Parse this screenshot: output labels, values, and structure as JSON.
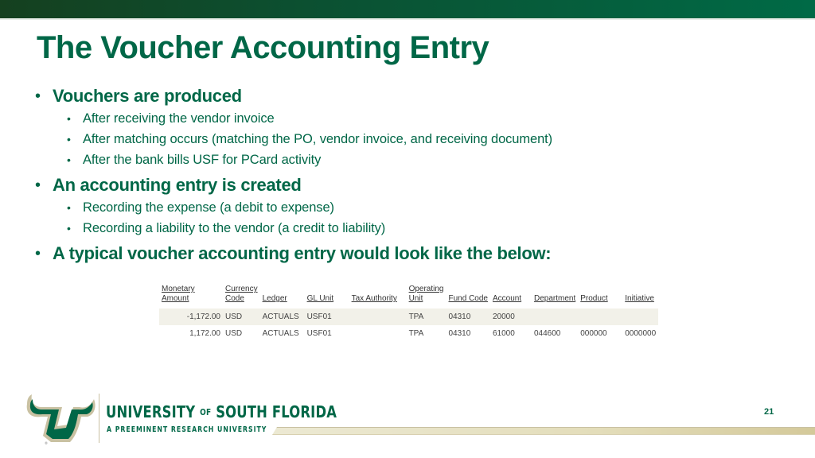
{
  "colors": {
    "brand_green": "#006747",
    "gold": "#CFC493"
  },
  "slide": {
    "title": "The Voucher Accounting Entry",
    "bullets": [
      {
        "text": "Vouchers are produced",
        "sub": [
          "After receiving the vendor invoice",
          "After matching occurs (matching the PO, vendor invoice, and receiving document)",
          "After the bank bills USF for PCard activity"
        ]
      },
      {
        "text": "An accounting entry is created",
        "sub": [
          "Recording the expense (a debit to expense)",
          "Recording a liability to the vendor (a credit to liability)"
        ]
      },
      {
        "text": "A typical voucher accounting entry would look like the below:",
        "sub": []
      }
    ],
    "page_number": "21"
  },
  "table": {
    "headers": [
      [
        "Monetary",
        "Amount"
      ],
      [
        "Currency",
        "Code"
      ],
      [
        "Ledger",
        ""
      ],
      [
        "GL Unit",
        ""
      ],
      [
        "Tax Authority",
        ""
      ],
      [
        "Operating",
        "Unit"
      ],
      [
        "Fund Code",
        ""
      ],
      [
        "Account",
        ""
      ],
      [
        "Department",
        ""
      ],
      [
        "Product",
        ""
      ],
      [
        "Initiative",
        ""
      ]
    ],
    "rows": [
      [
        "-1,172.00",
        "USD",
        "ACTUALS",
        "USF01",
        "",
        "TPA",
        "04310",
        "20000",
        "",
        "",
        ""
      ],
      [
        "1,172.00",
        "USD",
        "ACTUALS",
        "USF01",
        "",
        "TPA",
        "04310",
        "61000",
        "044600",
        "000000",
        "0000000"
      ]
    ]
  },
  "footer": {
    "logo_icon": "usf-bull-horns-logo",
    "university_name_1": "UNIVERSITY",
    "university_of": "OF",
    "university_name_2": "SOUTH FLORIDA",
    "tagline": "A PREEMINENT RESEARCH UNIVERSITY"
  }
}
